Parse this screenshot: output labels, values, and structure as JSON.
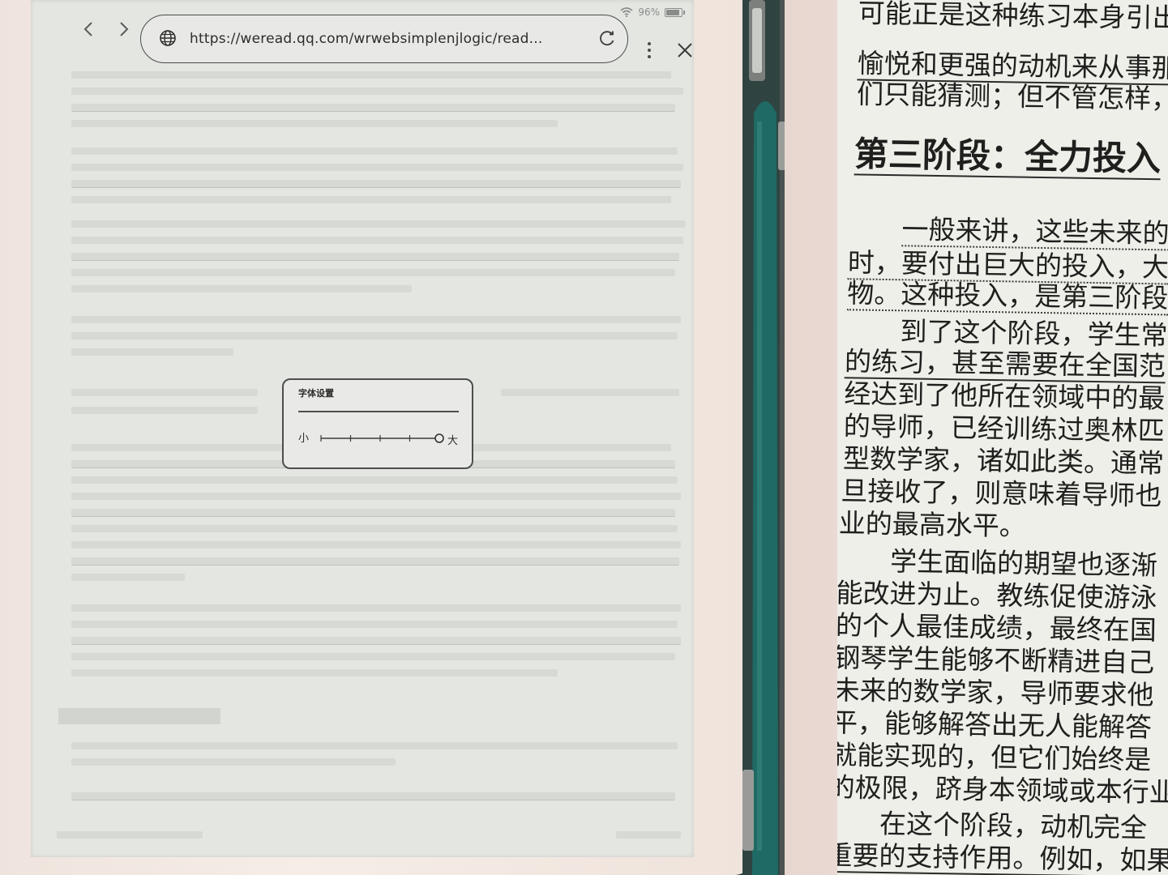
{
  "status": {
    "battery": "96%"
  },
  "browser": {
    "url": "https://weread.qq.com/wrwebsimplenjlogic/read..."
  },
  "font_dialog": {
    "title": "字体设置",
    "small_label": "小",
    "large_label": "大",
    "level": 5,
    "levels": 5
  },
  "book": {
    "lines": [
      "可能正是这种练习本身引出",
      "愉悦和更强的动机来从事那",
      "们只能猜测；但不管怎样，",
      "第三阶段：全力投入",
      "一般来讲，这些未来的",
      "时，要付出巨大的投入，大",
      "物。这种投入，是第三阶段",
      "到了这个阶段，学生常",
      "的练习，甚至需要在全国范",
      "经达到了他所在领域中的最",
      "的导师，已经训练过奥林匹",
      "型数学家，诸如此类。通常",
      "旦接收了，则意味着导师也",
      "业的最高水平。",
      "学生面临的期望也逐渐",
      "能改进为止。教练促使游泳",
      "的个人最佳成绩，最终在国",
      "钢琴学生能够不断精进自己",
      "未来的数学家，导师要求他",
      "平，能够解答出无人能解答",
      "就能实现的，但它们始终是",
      "的极限，跻身本领域或本行业",
      "在这个阶段，动机完全",
      "重要的支持作用。例如，如果"
    ]
  }
}
